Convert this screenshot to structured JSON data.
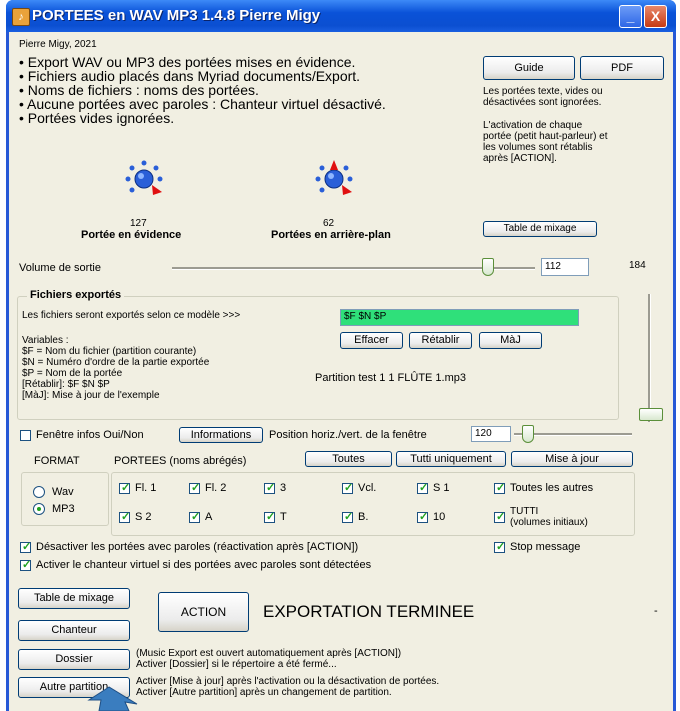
{
  "window": {
    "title": "PORTEES en WAV MP3 1.4.8 Pierre Migy",
    "minimize": "_",
    "close": "X"
  },
  "header": {
    "author": "Pierre Migy, 2021",
    "bullets": [
      "• Export WAV ou MP3 des portées mises en évidence.",
      "• Fichiers audio placés dans Myriad documents/Export.",
      "• Noms de fichiers : noms des portées.",
      "• Aucune portées avec paroles : Chanteur virtuel désactivé.",
      "• Portées vides ignorées."
    ]
  },
  "help": {
    "guide": "Guide",
    "pdf": "PDF",
    "note1": [
      "Les portées texte, vides ou",
      "désactivées sont ignorées."
    ],
    "note2": [
      "L'activation de chaque",
      "portée (petit haut-parleur) et",
      "les volumes sont  rétablis",
      "après [ACTION]."
    ]
  },
  "knobs": {
    "foreground": {
      "value": "127",
      "label": "Portée en évidence"
    },
    "background": {
      "value": "62",
      "label": "Portées en arrière-plan"
    }
  },
  "table_mixage_top": "Table de mixage",
  "volume": {
    "label": "Volume de sortie",
    "value": "112",
    "max": "184",
    "level": 0.61
  },
  "export": {
    "legend": "Fichiers exportés",
    "model_label": "Les fichiers seront exportés selon ce modèle >>>",
    "model_value": "$F $N $P",
    "effacer": "Effacer",
    "retablir": "Rétablir",
    "maj": "MàJ",
    "variables": [
      "Variables :",
      "$F = Nom du fichier (partition courante)",
      "$N = Numéro d'ordre de la partie exportée",
      "$P = Nom de la portée",
      "[Rétablir]: $F $N $P",
      "[MàJ]: Mise à jour de l'exemple"
    ],
    "example": "Partition test 1 1 FLÛTE 1.mp3"
  },
  "infos": {
    "checkbox": "Fenêtre infos Oui/Non",
    "informations": "Informations",
    "position_label": "Position horiz./vert. de la fenêtre",
    "position_value": "120"
  },
  "format": {
    "label": "FORMAT",
    "wav": "Wav",
    "mp3": "MP3",
    "selected": "MP3"
  },
  "portees": {
    "label": "PORTEES (noms abrégés)",
    "toutes": "Toutes",
    "tutti_uniquement": "Tutti uniquement",
    "mise_a_jour": "Mise à jour",
    "row1": [
      "Fl. 1",
      "Fl. 2",
      "3",
      "Vcl.",
      "S 1",
      "Toutes les autres"
    ],
    "row2": [
      "S 2",
      "A",
      "T",
      "B.",
      "10"
    ],
    "tutti": [
      "TUTTI",
      "(volumes initiaux)"
    ]
  },
  "options": {
    "desactiver": "Désactiver les portées avec paroles (réactivation après [ACTION])",
    "stop": "Stop message",
    "activer": "Activer le chanteur virtuel si des portées avec paroles sont détectées"
  },
  "bottom": {
    "table_mixage": "Table de mixage",
    "chanteur": "Chanteur",
    "dossier": "Dossier",
    "autre_partition": "Autre partition",
    "action": "ACTION",
    "status": "EXPORTATION TERMINEE",
    "dossier_note": [
      "(Music Export est ouvert automatiquement après [ACTION])",
      "Activer [Dossier] si le répertoire a été fermé..."
    ],
    "autre_note": [
      "Activer [Mise à jour] après l'activation ou la désactivation de portées.",
      "Activer [Autre partition] après un changement de partition."
    ],
    "dash": "-"
  },
  "colors": {
    "titlebar": "#0b4fd1",
    "client": "#f1efe2",
    "model_field": "#2fe07a",
    "check": "#21a121"
  }
}
